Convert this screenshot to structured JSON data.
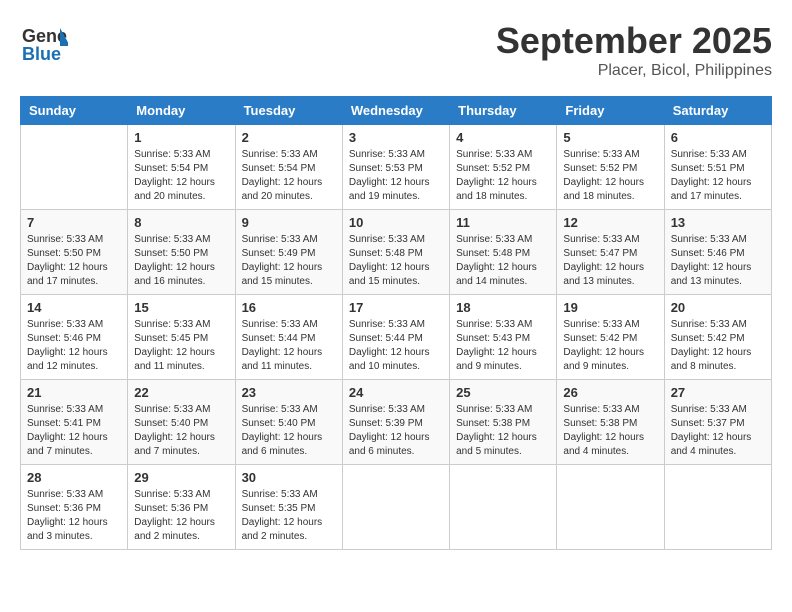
{
  "header": {
    "logo_line1": "General",
    "logo_line2": "Blue",
    "title": "September 2025",
    "subtitle": "Placer, Bicol, Philippines"
  },
  "calendar": {
    "days_of_week": [
      "Sunday",
      "Monday",
      "Tuesday",
      "Wednesday",
      "Thursday",
      "Friday",
      "Saturday"
    ],
    "weeks": [
      [
        {
          "day": "",
          "info": ""
        },
        {
          "day": "1",
          "info": "Sunrise: 5:33 AM\nSunset: 5:54 PM\nDaylight: 12 hours\nand 20 minutes."
        },
        {
          "day": "2",
          "info": "Sunrise: 5:33 AM\nSunset: 5:54 PM\nDaylight: 12 hours\nand 20 minutes."
        },
        {
          "day": "3",
          "info": "Sunrise: 5:33 AM\nSunset: 5:53 PM\nDaylight: 12 hours\nand 19 minutes."
        },
        {
          "day": "4",
          "info": "Sunrise: 5:33 AM\nSunset: 5:52 PM\nDaylight: 12 hours\nand 18 minutes."
        },
        {
          "day": "5",
          "info": "Sunrise: 5:33 AM\nSunset: 5:52 PM\nDaylight: 12 hours\nand 18 minutes."
        },
        {
          "day": "6",
          "info": "Sunrise: 5:33 AM\nSunset: 5:51 PM\nDaylight: 12 hours\nand 17 minutes."
        }
      ],
      [
        {
          "day": "7",
          "info": "Sunrise: 5:33 AM\nSunset: 5:50 PM\nDaylight: 12 hours\nand 17 minutes."
        },
        {
          "day": "8",
          "info": "Sunrise: 5:33 AM\nSunset: 5:50 PM\nDaylight: 12 hours\nand 16 minutes."
        },
        {
          "day": "9",
          "info": "Sunrise: 5:33 AM\nSunset: 5:49 PM\nDaylight: 12 hours\nand 15 minutes."
        },
        {
          "day": "10",
          "info": "Sunrise: 5:33 AM\nSunset: 5:48 PM\nDaylight: 12 hours\nand 15 minutes."
        },
        {
          "day": "11",
          "info": "Sunrise: 5:33 AM\nSunset: 5:48 PM\nDaylight: 12 hours\nand 14 minutes."
        },
        {
          "day": "12",
          "info": "Sunrise: 5:33 AM\nSunset: 5:47 PM\nDaylight: 12 hours\nand 13 minutes."
        },
        {
          "day": "13",
          "info": "Sunrise: 5:33 AM\nSunset: 5:46 PM\nDaylight: 12 hours\nand 13 minutes."
        }
      ],
      [
        {
          "day": "14",
          "info": "Sunrise: 5:33 AM\nSunset: 5:46 PM\nDaylight: 12 hours\nand 12 minutes."
        },
        {
          "day": "15",
          "info": "Sunrise: 5:33 AM\nSunset: 5:45 PM\nDaylight: 12 hours\nand 11 minutes."
        },
        {
          "day": "16",
          "info": "Sunrise: 5:33 AM\nSunset: 5:44 PM\nDaylight: 12 hours\nand 11 minutes."
        },
        {
          "day": "17",
          "info": "Sunrise: 5:33 AM\nSunset: 5:44 PM\nDaylight: 12 hours\nand 10 minutes."
        },
        {
          "day": "18",
          "info": "Sunrise: 5:33 AM\nSunset: 5:43 PM\nDaylight: 12 hours\nand 9 minutes."
        },
        {
          "day": "19",
          "info": "Sunrise: 5:33 AM\nSunset: 5:42 PM\nDaylight: 12 hours\nand 9 minutes."
        },
        {
          "day": "20",
          "info": "Sunrise: 5:33 AM\nSunset: 5:42 PM\nDaylight: 12 hours\nand 8 minutes."
        }
      ],
      [
        {
          "day": "21",
          "info": "Sunrise: 5:33 AM\nSunset: 5:41 PM\nDaylight: 12 hours\nand 7 minutes."
        },
        {
          "day": "22",
          "info": "Sunrise: 5:33 AM\nSunset: 5:40 PM\nDaylight: 12 hours\nand 7 minutes."
        },
        {
          "day": "23",
          "info": "Sunrise: 5:33 AM\nSunset: 5:40 PM\nDaylight: 12 hours\nand 6 minutes."
        },
        {
          "day": "24",
          "info": "Sunrise: 5:33 AM\nSunset: 5:39 PM\nDaylight: 12 hours\nand 6 minutes."
        },
        {
          "day": "25",
          "info": "Sunrise: 5:33 AM\nSunset: 5:38 PM\nDaylight: 12 hours\nand 5 minutes."
        },
        {
          "day": "26",
          "info": "Sunrise: 5:33 AM\nSunset: 5:38 PM\nDaylight: 12 hours\nand 4 minutes."
        },
        {
          "day": "27",
          "info": "Sunrise: 5:33 AM\nSunset: 5:37 PM\nDaylight: 12 hours\nand 4 minutes."
        }
      ],
      [
        {
          "day": "28",
          "info": "Sunrise: 5:33 AM\nSunset: 5:36 PM\nDaylight: 12 hours\nand 3 minutes."
        },
        {
          "day": "29",
          "info": "Sunrise: 5:33 AM\nSunset: 5:36 PM\nDaylight: 12 hours\nand 2 minutes."
        },
        {
          "day": "30",
          "info": "Sunrise: 5:33 AM\nSunset: 5:35 PM\nDaylight: 12 hours\nand 2 minutes."
        },
        {
          "day": "",
          "info": ""
        },
        {
          "day": "",
          "info": ""
        },
        {
          "day": "",
          "info": ""
        },
        {
          "day": "",
          "info": ""
        }
      ]
    ]
  }
}
